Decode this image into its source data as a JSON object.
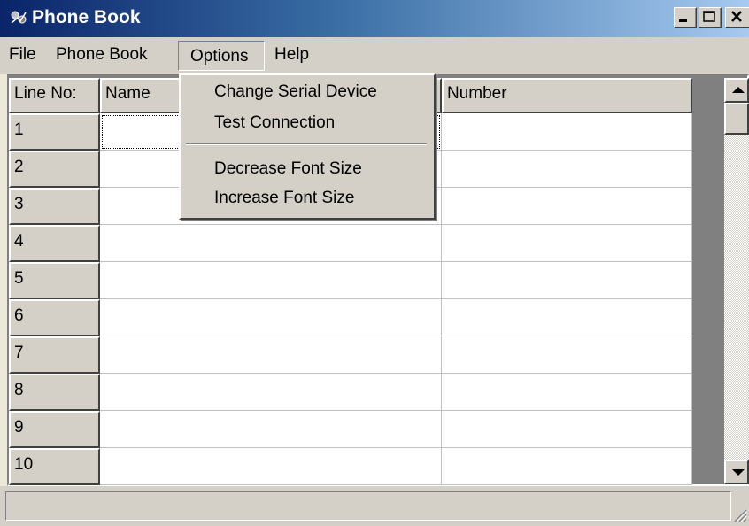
{
  "window": {
    "title": "Phone Book",
    "icon": "phone-book-app-icon"
  },
  "menu": {
    "file": "File",
    "phone_book": "Phone Book",
    "options": "Options",
    "help": "Help"
  },
  "options_menu": {
    "items": [
      "Change Serial Device",
      "Test Connection",
      "Decrease Font Size",
      "Increase Font Size"
    ]
  },
  "grid": {
    "headers": {
      "line_no": "Line No:",
      "name": "Name",
      "number": "Number"
    },
    "rows": [
      {
        "line": "1",
        "name": "",
        "number": ""
      },
      {
        "line": "2",
        "name": "",
        "number": ""
      },
      {
        "line": "3",
        "name": "",
        "number": ""
      },
      {
        "line": "4",
        "name": "",
        "number": ""
      },
      {
        "line": "5",
        "name": "",
        "number": ""
      },
      {
        "line": "6",
        "name": "",
        "number": ""
      },
      {
        "line": "7",
        "name": "",
        "number": ""
      },
      {
        "line": "8",
        "name": "",
        "number": ""
      },
      {
        "line": "9",
        "name": "",
        "number": ""
      },
      {
        "line": "10",
        "name": "",
        "number": ""
      }
    ]
  },
  "status": {
    "text": ""
  },
  "colors": {
    "titlebar_start": "#0a246a",
    "titlebar_end": "#a6caf0",
    "face": "#d4d0c8"
  }
}
